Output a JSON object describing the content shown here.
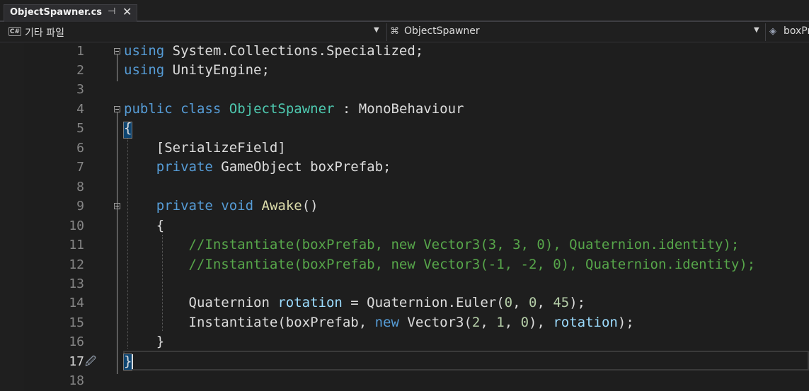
{
  "tab": {
    "title": "ObjectSpawner.cs",
    "pin": "⊣",
    "close": "✕"
  },
  "navbar": {
    "project": "기타 파일",
    "project_icon": "C#",
    "class": "ObjectSpawner",
    "member": "boxPrefab"
  },
  "editor": {
    "active_line": 17,
    "line_numbers": [
      "1",
      "2",
      "3",
      "4",
      "5",
      "6",
      "7",
      "8",
      "9",
      "10",
      "11",
      "12",
      "13",
      "14",
      "15",
      "16",
      "17",
      "18"
    ]
  },
  "colors": {
    "keyword": "#569cd6",
    "type": "#4ec9b0",
    "method": "#dcdcaa",
    "comment": "#57a64a",
    "number": "#b5cea8",
    "variable": "#9cdcfe"
  }
}
